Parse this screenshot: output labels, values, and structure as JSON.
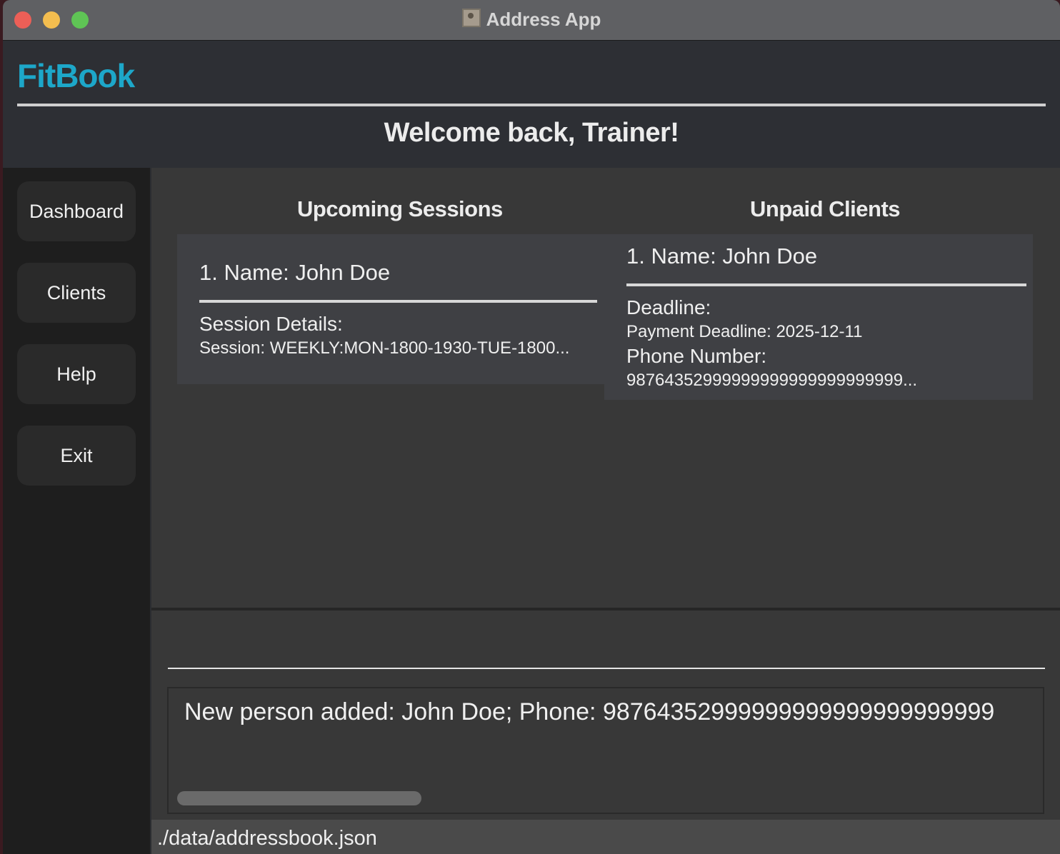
{
  "window": {
    "title": "Address App"
  },
  "header": {
    "brand": "FitBook",
    "welcome": "Welcome back, Trainer!",
    "brand_color": "#1da7c9"
  },
  "sidebar": {
    "items": [
      {
        "label": "Dashboard"
      },
      {
        "label": "Clients"
      },
      {
        "label": "Help"
      },
      {
        "label": "Exit"
      }
    ]
  },
  "upcoming": {
    "title": "Upcoming Sessions",
    "items": [
      {
        "name": "1. Name: John Doe",
        "details_label": "Session Details:",
        "details_value": "Session: WEEKLY:MON-1800-1930-TUE-1800..."
      }
    ]
  },
  "unpaid": {
    "title": "Unpaid Clients",
    "items": [
      {
        "name": "1. Name: John Doe",
        "deadline_label": "Deadline:",
        "deadline_value": "Payment Deadline: 2025-12-11",
        "phone_label": "Phone Number:",
        "phone_value": "98764352999999999999999999999..."
      }
    ]
  },
  "command": {
    "value": ""
  },
  "result": {
    "text": "New person added: John Doe; Phone: 98764352999999999999999999999"
  },
  "status": {
    "path": "./data/addressbook.json"
  }
}
